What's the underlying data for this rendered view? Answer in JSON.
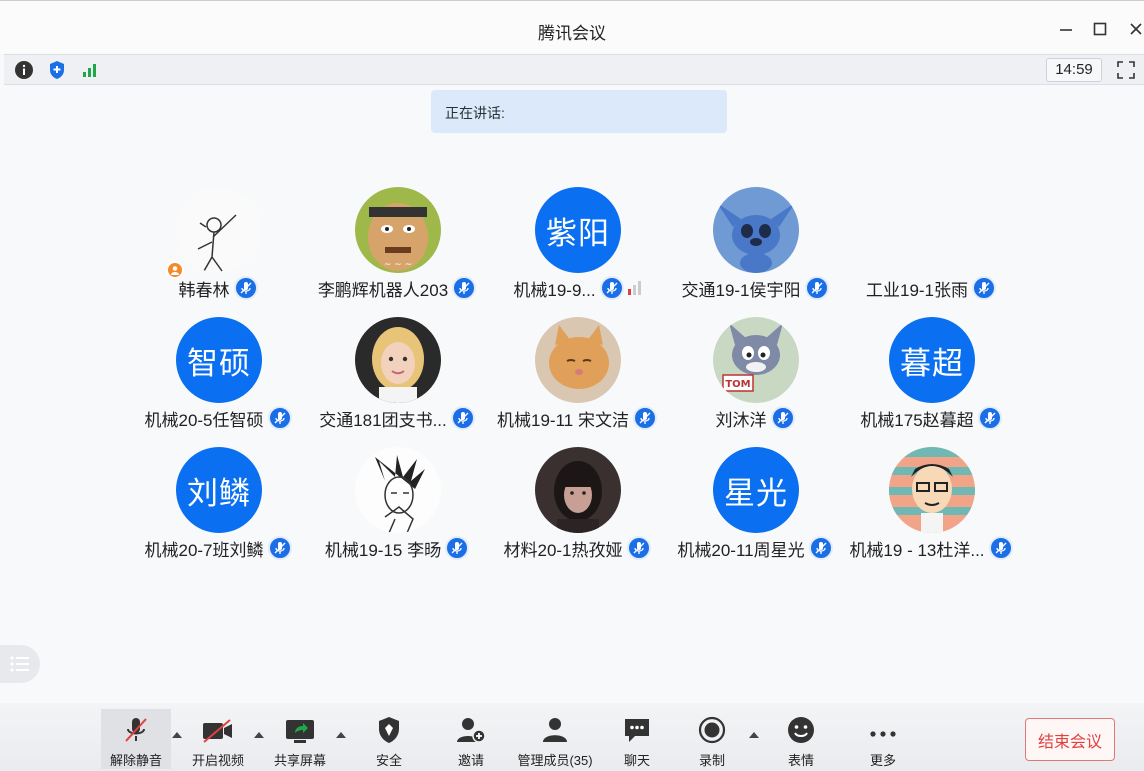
{
  "window": {
    "title": "腾讯会议"
  },
  "infobar": {
    "time": "14:59"
  },
  "speaking": {
    "label": "正在讲话:"
  },
  "participants": [
    {
      "name": "韩春林",
      "avatar_type": "image",
      "avatar_desc": "sketch-figure"
    },
    {
      "name": "李鹏辉机器人203",
      "avatar_type": "image",
      "avatar_desc": "cartoon-face"
    },
    {
      "name": "机械19-9...",
      "avatar_type": "text",
      "avatar_text": "紫阳"
    },
    {
      "name": "交通19-1侯宇阳",
      "avatar_type": "image",
      "avatar_desc": "stitch"
    },
    {
      "name": "工业19-1张雨",
      "avatar_type": "none"
    },
    {
      "name": "机械20-5任智硕",
      "avatar_type": "text",
      "avatar_text": "智硕"
    },
    {
      "name": "交通181团支书...",
      "avatar_type": "image",
      "avatar_desc": "girl-photo"
    },
    {
      "name": "机械19-11 宋文洁",
      "avatar_type": "image",
      "avatar_desc": "cat-photo"
    },
    {
      "name": "刘沐洋",
      "avatar_type": "image",
      "avatar_desc": "tom-cat"
    },
    {
      "name": "机械175赵暮超",
      "avatar_type": "text",
      "avatar_text": "暮超"
    },
    {
      "name": "机械20-7班刘鳞",
      "avatar_type": "text",
      "avatar_text": "刘鳞"
    },
    {
      "name": "机械19-15 李旸",
      "avatar_type": "image",
      "avatar_desc": "manga-sketch"
    },
    {
      "name": "材料20-1热孜娅",
      "avatar_type": "image",
      "avatar_desc": "dark-portrait"
    },
    {
      "name": "机械20-11周星光",
      "avatar_type": "text",
      "avatar_text": "星光"
    },
    {
      "name": "机械19 - 13杜洋...",
      "avatar_type": "image",
      "avatar_desc": "glasses-cartoon"
    }
  ],
  "toolbar": {
    "unmute": "解除静音",
    "video": "开启视频",
    "share": "共享屏幕",
    "security": "安全",
    "invite": "邀请",
    "members": "管理成员(35)",
    "chat": "聊天",
    "record": "录制",
    "reaction": "表情",
    "more": "更多",
    "end": "结束会议"
  },
  "colors": {
    "accent": "#0a6ff0",
    "end": "#e0413e",
    "signal_green": "#1fa84a"
  }
}
